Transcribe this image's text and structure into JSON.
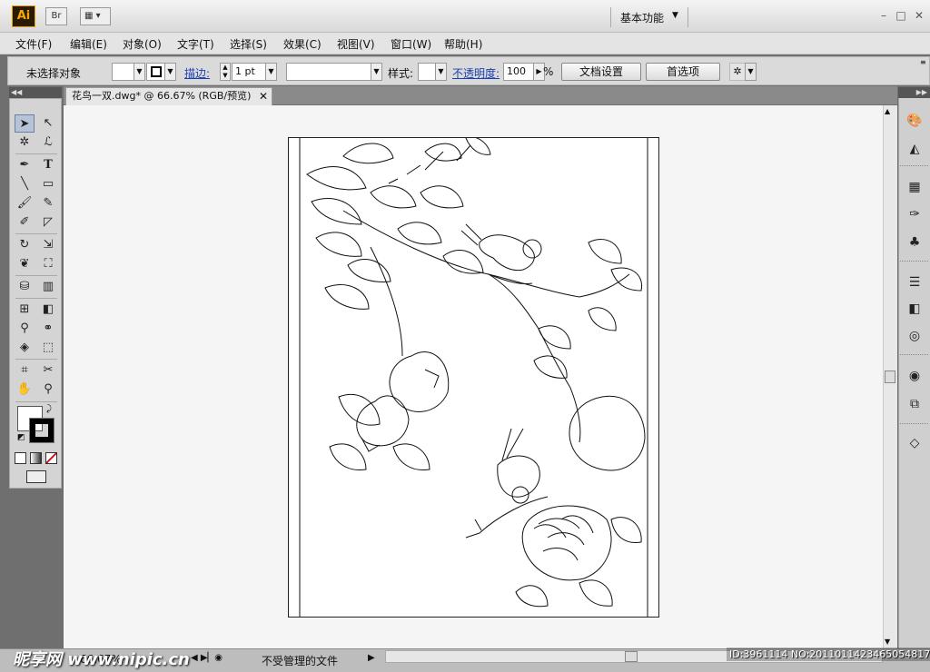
{
  "app": {
    "logo": "Ai",
    "bridge_label": "Br",
    "workspace": "基本功能"
  },
  "window": {
    "minimize": "–",
    "restore": "□",
    "close": "✕"
  },
  "menu": [
    "文件(F)",
    "编辑(E)",
    "对象(O)",
    "文字(T)",
    "选择(S)",
    "效果(C)",
    "视图(V)",
    "窗口(W)",
    "帮助(H)"
  ],
  "control": {
    "selection_status": "未选择对象",
    "stroke_label": "描边:",
    "stroke_weight": "1 pt",
    "style_label": "样式:",
    "opacity_label": "不透明度:",
    "opacity_value": "100",
    "opacity_unit": "%",
    "doc_setup": "文档设置",
    "preferences": "首选项"
  },
  "document": {
    "tab_title": "花鸟一双.dwg* @ 66.67% (RGB/预览)",
    "tab_close": "✕"
  },
  "status": {
    "zoom": "66.67%",
    "management": "不受管理的文件"
  },
  "overlay": {
    "watermark": "昵享网 www.nipic.cn",
    "id": "ID:3961114 NO:20110114234650548172"
  },
  "colors": {
    "fill": "#ffffff",
    "stroke": "#000000",
    "ui_bg": "#d4d4d4"
  },
  "icons": {
    "tools": [
      "selection",
      "direct-selection",
      "magic-wand",
      "lasso",
      "pen",
      "type",
      "line",
      "rectangle",
      "paintbrush",
      "pencil",
      "blob-brush",
      "eraser",
      "rotate",
      "scale",
      "warp",
      "free-transform",
      "symbol-sprayer",
      "column-graph",
      "mesh",
      "gradient",
      "eyedropper",
      "blend",
      "live-paint",
      "live-paint-selection",
      "crop",
      "slice",
      "hand",
      "zoom"
    ],
    "panels": [
      "color-guide",
      "color",
      "swatches",
      "brushes",
      "symbols",
      "stroke",
      "gradient",
      "transparency",
      "appearance",
      "graphic-styles",
      "layers"
    ]
  }
}
